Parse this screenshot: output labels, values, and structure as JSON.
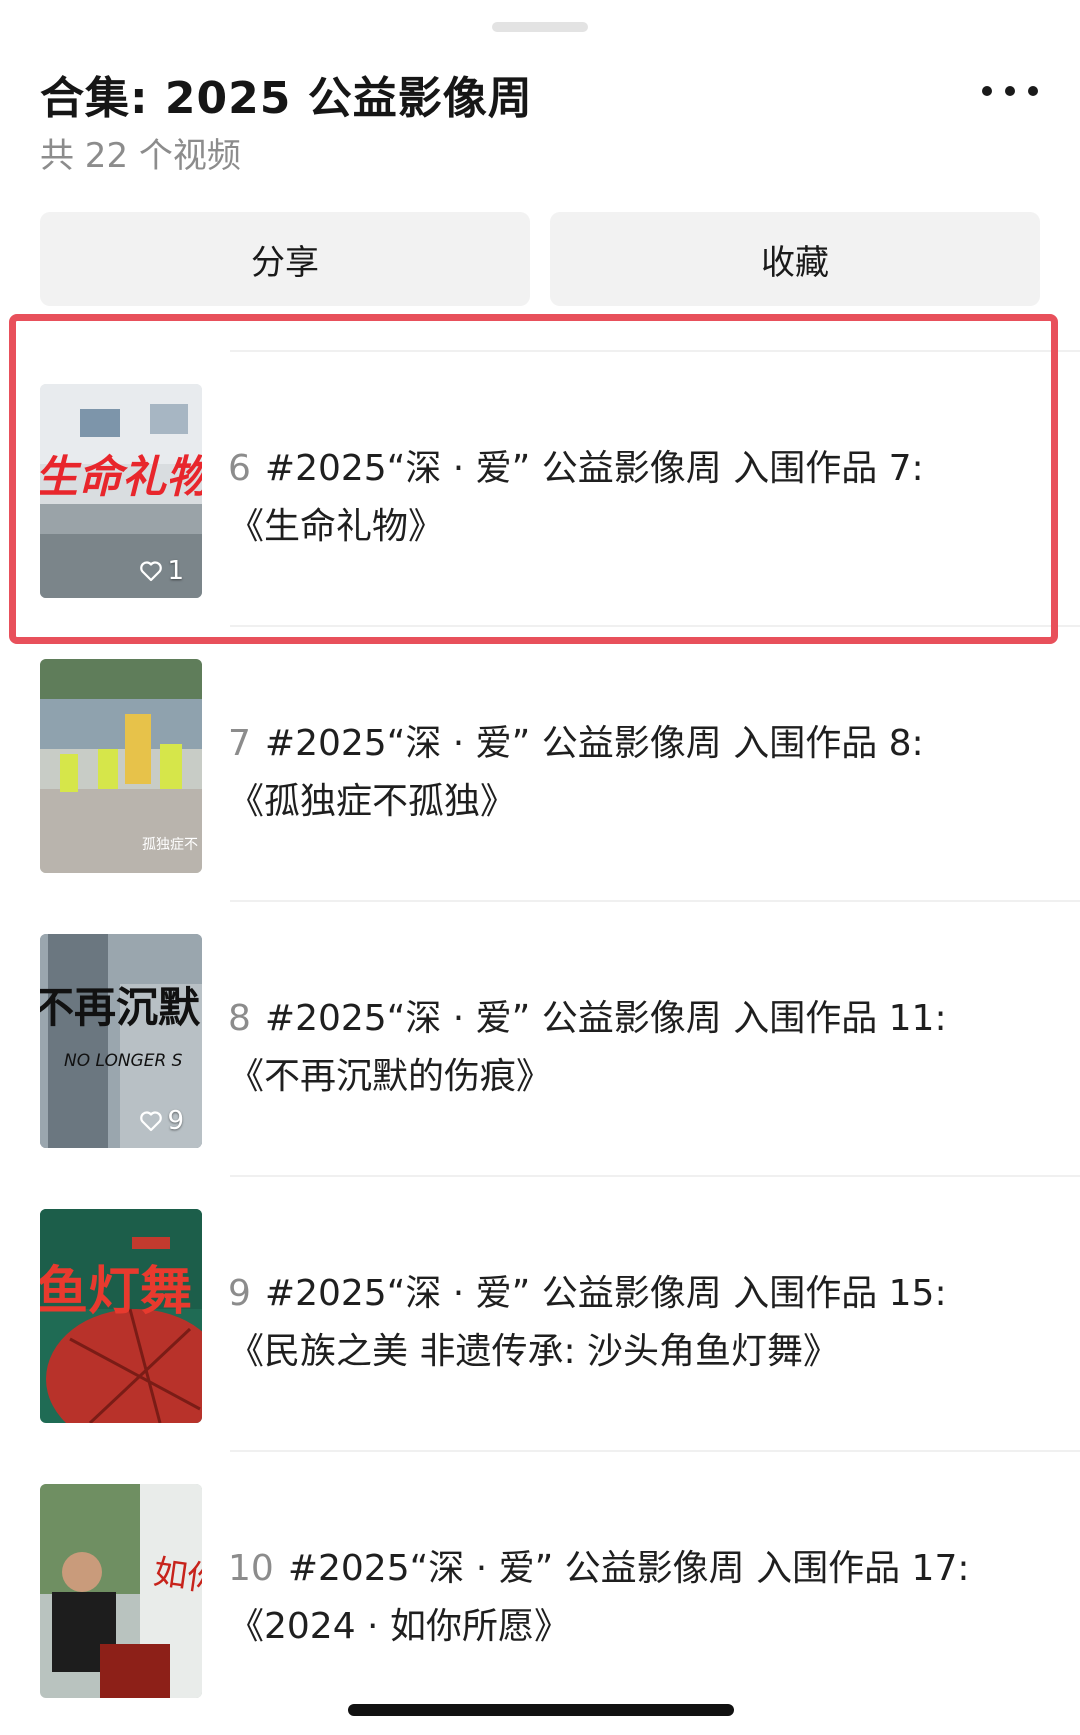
{
  "header": {
    "title": "合集: 2025 公益影像周",
    "subtitle": "共 22 个视频",
    "more_icon": "more-horizontal-icon"
  },
  "actions": {
    "share_label": "分享",
    "favorite_label": "收藏"
  },
  "items": [
    {
      "index": "6",
      "title_line1": "#2025“深 · 爱” 公益影像周 入围作品 7:",
      "title_line2": "《生命礼物》",
      "likes": "1",
      "thumb_text": "生命礼物",
      "highlighted": true
    },
    {
      "index": "7",
      "title_line1": "#2025“深 · 爱” 公益影像周 入围作品 8:",
      "title_line2": "《孤独症不孤独》",
      "likes": "",
      "thumb_text": "孤独症不",
      "highlighted": false
    },
    {
      "index": "8",
      "title_line1": "#2025“深 · 爱” 公益影像周 入围作品 11:",
      "title_line2": "《不再沉默的伤痕》",
      "likes": "9",
      "thumb_text": "不再沉默",
      "thumb_subtext": "NO LONGER S",
      "highlighted": false
    },
    {
      "index": "9",
      "title_line1": "#2025“深 · 爱” 公益影像周 入围作品 15:",
      "title_line2": "《民族之美 非遗传承:  沙头角鱼灯舞》",
      "likes": "",
      "thumb_text": "鱼灯舞",
      "highlighted": false
    },
    {
      "index": "10",
      "title_line1": "#2025“深 · 爱” 公益影像周 入围作品 17:",
      "title_line2": "《2024 · 如你所愿》",
      "likes": "",
      "thumb_text": "如你所愿",
      "highlighted": false
    }
  ],
  "colors": {
    "highlight": "#e8505b",
    "button_bg": "#f2f2f2",
    "muted_text": "#8c8c8c"
  }
}
